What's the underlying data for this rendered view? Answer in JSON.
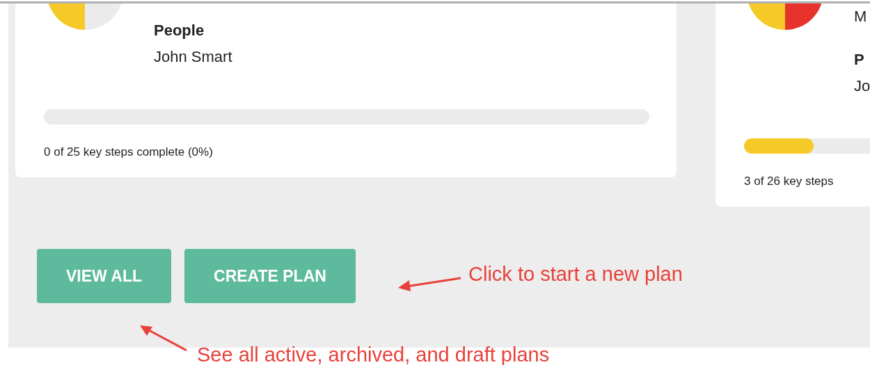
{
  "cards": [
    {
      "pie": [
        {
          "color": "#f5c928"
        },
        {
          "color": "#ebebeb"
        }
      ],
      "lines": [
        {
          "kind": "label",
          "text": "People"
        },
        {
          "kind": "value",
          "text": "John Smart"
        }
      ],
      "level": 0,
      "progress_text": "0 of 25 key steps complete (0%)"
    },
    {
      "pie": [
        {
          "color": "#f5c928"
        },
        {
          "color": "#e8322c"
        }
      ],
      "lines": [
        {
          "kind": "value",
          "text": "M"
        },
        {
          "kind": "label",
          "text": "P"
        },
        {
          "kind": "value",
          "text": "Jo"
        }
      ],
      "level": 0.115,
      "progress_text": "3 of 26 key steps"
    }
  ],
  "buttons": [
    "VIEW ALL",
    "CREATE PLAN"
  ],
  "annotations": [
    {
      "text": "Click to start a new plan"
    },
    {
      "text": "See all active, archived, and draft plans"
    }
  ]
}
